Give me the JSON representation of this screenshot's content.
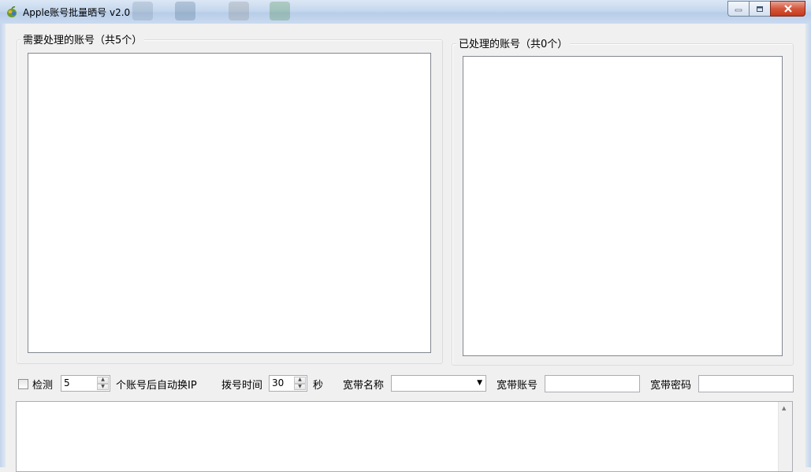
{
  "window": {
    "title": "Apple账号批量晒号 v2.0",
    "title_icon": "apple-logo-icon",
    "buttons": {
      "minimize": "minimize-icon",
      "maximize": "maximize-icon",
      "close": "close-icon"
    }
  },
  "pending": {
    "label": "需要处理的账号（共5个）",
    "items": []
  },
  "processed": {
    "label": "已处理的账号（共0个）",
    "items": []
  },
  "controls": {
    "detect_checkbox_checked": false,
    "detect_label": "检测",
    "detect_count": "5",
    "switch_ip_label": "个账号后自动换IP",
    "dial_time_label": "拨号时间",
    "dial_time_value": "30",
    "seconds_label": "秒",
    "broadband_name_label": "宽带名称",
    "broadband_name_value": "",
    "broadband_account_label": "宽带账号",
    "broadband_account_value": "",
    "broadband_password_label": "宽带密码",
    "broadband_password_value": ""
  },
  "log": {
    "text": ""
  },
  "colors": {
    "window_bg": "#f0f0f0",
    "title_gradient_top": "#dbe7f5",
    "close_red": "#c7391b"
  }
}
